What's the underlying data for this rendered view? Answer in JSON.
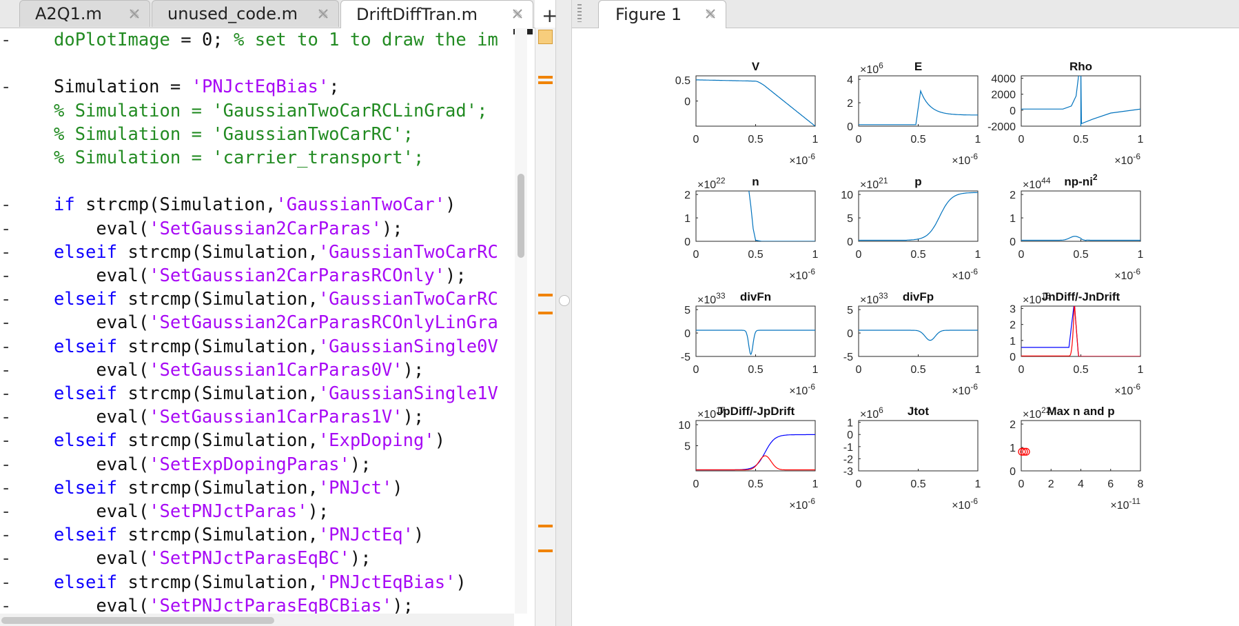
{
  "editor": {
    "tabs": [
      {
        "label": "A2Q1.m",
        "active": false
      },
      {
        "label": "unused_code.m",
        "active": false
      },
      {
        "label": "DriftDiffTran.m",
        "active": true
      }
    ],
    "new_tab_label": "+",
    "lines": [
      {
        "marker": "-",
        "segments": [
          [
            "cm",
            "doPlotImage"
          ],
          [
            "tx",
            " = 0; "
          ],
          [
            "cm",
            "% set to 1 to draw the im"
          ]
        ]
      },
      {
        "marker": "",
        "segments": []
      },
      {
        "marker": "-",
        "segments": [
          [
            "tx",
            "Simulation = "
          ],
          [
            "st",
            "'PNJctEqBias'"
          ],
          [
            "tx",
            ";"
          ]
        ]
      },
      {
        "marker": "",
        "segments": [
          [
            "cm",
            "% Simulation = 'GaussianTwoCarRCLinGrad';"
          ]
        ]
      },
      {
        "marker": "",
        "segments": [
          [
            "cm",
            "% Simulation = 'GaussianTwoCarRC';"
          ]
        ]
      },
      {
        "marker": "",
        "segments": [
          [
            "cm",
            "% Simulation = 'carrier_transport';"
          ]
        ]
      },
      {
        "marker": "",
        "segments": []
      },
      {
        "marker": "-",
        "segments": [
          [
            "kw",
            "if"
          ],
          [
            "tx",
            " strcmp(Simulation,"
          ],
          [
            "st",
            "'GaussianTwoCar'"
          ],
          [
            "tx",
            ")"
          ]
        ]
      },
      {
        "marker": "-",
        "segments": [
          [
            "tx",
            "    eval("
          ],
          [
            "st",
            "'SetGaussian2CarParas'"
          ],
          [
            "tx",
            ");"
          ]
        ]
      },
      {
        "marker": "-",
        "segments": [
          [
            "kw",
            "elseif"
          ],
          [
            "tx",
            " strcmp(Simulation,"
          ],
          [
            "st",
            "'GaussianTwoCarRC"
          ]
        ]
      },
      {
        "marker": "-",
        "segments": [
          [
            "tx",
            "    eval("
          ],
          [
            "st",
            "'SetGaussian2CarParasRCOnly'"
          ],
          [
            "tx",
            ");"
          ]
        ]
      },
      {
        "marker": "-",
        "segments": [
          [
            "kw",
            "elseif"
          ],
          [
            "tx",
            " strcmp(Simulation,"
          ],
          [
            "st",
            "'GaussianTwoCarRC"
          ]
        ]
      },
      {
        "marker": "-",
        "segments": [
          [
            "tx",
            "    eval("
          ],
          [
            "st",
            "'SetGaussian2CarParasRCOnlyLinGra"
          ]
        ]
      },
      {
        "marker": "-",
        "segments": [
          [
            "kw",
            "elseif"
          ],
          [
            "tx",
            " strcmp(Simulation,"
          ],
          [
            "st",
            "'GaussianSingle0V"
          ]
        ]
      },
      {
        "marker": "-",
        "segments": [
          [
            "tx",
            "    eval("
          ],
          [
            "st",
            "'SetGaussian1CarParas0V'"
          ],
          [
            "tx",
            ");"
          ]
        ]
      },
      {
        "marker": "-",
        "segments": [
          [
            "kw",
            "elseif"
          ],
          [
            "tx",
            " strcmp(Simulation,"
          ],
          [
            "st",
            "'GaussianSingle1V"
          ]
        ]
      },
      {
        "marker": "-",
        "segments": [
          [
            "tx",
            "    eval("
          ],
          [
            "st",
            "'SetGaussian1CarParas1V'"
          ],
          [
            "tx",
            ");"
          ]
        ]
      },
      {
        "marker": "-",
        "segments": [
          [
            "kw",
            "elseif"
          ],
          [
            "tx",
            " strcmp(Simulation,"
          ],
          [
            "st",
            "'ExpDoping'"
          ],
          [
            "tx",
            ")"
          ]
        ]
      },
      {
        "marker": "-",
        "segments": [
          [
            "tx",
            "    eval("
          ],
          [
            "st",
            "'SetExpDopingParas'"
          ],
          [
            "tx",
            ");"
          ]
        ]
      },
      {
        "marker": "-",
        "segments": [
          [
            "kw",
            "elseif"
          ],
          [
            "tx",
            " strcmp(Simulation,"
          ],
          [
            "st",
            "'PNJct'"
          ],
          [
            "tx",
            ")"
          ]
        ]
      },
      {
        "marker": "-",
        "segments": [
          [
            "tx",
            "    eval("
          ],
          [
            "st",
            "'SetPNJctParas'"
          ],
          [
            "tx",
            ");"
          ]
        ]
      },
      {
        "marker": "-",
        "segments": [
          [
            "kw",
            "elseif"
          ],
          [
            "tx",
            " strcmp(Simulation,"
          ],
          [
            "st",
            "'PNJctEq'"
          ],
          [
            "tx",
            ")"
          ]
        ]
      },
      {
        "marker": "-",
        "segments": [
          [
            "tx",
            "    eval("
          ],
          [
            "st",
            "'SetPNJctParasEqBC'"
          ],
          [
            "tx",
            ");"
          ]
        ]
      },
      {
        "marker": "-",
        "segments": [
          [
            "kw",
            "elseif"
          ],
          [
            "tx",
            " strcmp(Simulation,"
          ],
          [
            "st",
            "'PNJctEqBias'"
          ],
          [
            "tx",
            ")"
          ]
        ]
      },
      {
        "marker": "-",
        "segments": [
          [
            "tx",
            "    eval("
          ],
          [
            "st",
            "'SetPNJctParasEqBCBias'"
          ],
          [
            "tx",
            ");"
          ]
        ]
      }
    ]
  },
  "figure": {
    "tab_label": "Figure 1",
    "subplots": [
      {
        "title": "V",
        "xticks": [
          "0",
          "0.5",
          "1"
        ],
        "xexp": "-6",
        "yticks": [
          "0",
          "0.5"
        ],
        "yexp": null,
        "color": "#0072bd",
        "shape": "V"
      },
      {
        "title": "E",
        "xticks": [
          "0",
          "0.5",
          "1"
        ],
        "xexp": "-6",
        "yticks": [
          "0",
          "2",
          "4"
        ],
        "yexp": "6",
        "color": "#0072bd",
        "shape": "E"
      },
      {
        "title": "Rho",
        "xticks": [
          "0",
          "0.5",
          "1"
        ],
        "xexp": "-6",
        "yticks": [
          "-2000",
          "0",
          "2000",
          "4000"
        ],
        "yexp": null,
        "color": "#0072bd",
        "shape": "Rho"
      },
      {
        "title": "n",
        "xticks": [
          "0",
          "0.5",
          "1"
        ],
        "xexp": "-6",
        "yticks": [
          "0",
          "1",
          "2"
        ],
        "yexp": "22",
        "color": "#0072bd",
        "shape": "n"
      },
      {
        "title": "p",
        "xticks": [
          "0",
          "0.5",
          "1"
        ],
        "xexp": "-6",
        "yticks": [
          "0",
          "5",
          "10"
        ],
        "yexp": "21",
        "color": "#0072bd",
        "shape": "p"
      },
      {
        "title": "np-ni",
        "title_sup": "2",
        "xticks": [
          "0",
          "0.5",
          "1"
        ],
        "xexp": "-6",
        "yticks": [
          "0",
          "1",
          "2"
        ],
        "yexp": "44",
        "color": "#0072bd",
        "shape": "npni"
      },
      {
        "title": "divFn",
        "xticks": [
          "0",
          "0.5",
          "1"
        ],
        "xexp": "-6",
        "yticks": [
          "-5",
          "0",
          "5"
        ],
        "yexp": "33",
        "color": "#0072bd",
        "shape": "divFn"
      },
      {
        "title": "divFp",
        "xticks": [
          "0",
          "0.5",
          "1"
        ],
        "xexp": "-6",
        "yticks": [
          "-5",
          "0",
          "5"
        ],
        "yexp": "33",
        "color": "#0072bd",
        "shape": "divFp"
      },
      {
        "title": "JnDiff/-JnDrift",
        "xticks": [
          "0",
          "0.5",
          "1"
        ],
        "xexp": "-6",
        "yticks": [
          "0",
          "1",
          "2",
          "3"
        ],
        "yexp": "18",
        "color": "#0000ff",
        "color2": "#ff0000",
        "shape": "Jn"
      },
      {
        "title": "JpDiff/-JpDrift",
        "xticks": [
          "0",
          "0.5",
          "1"
        ],
        "xexp": "-6",
        "yticks": [
          "5",
          "10"
        ],
        "yexp": "17",
        "color": "#0000ff",
        "color2": "#ff0000",
        "shape": "Jp"
      },
      {
        "title": "Jtot",
        "xticks": [
          "0",
          "0.5",
          "1"
        ],
        "xexp": "-6",
        "yticks": [
          "-3",
          "-2",
          "-1",
          "0",
          "1"
        ],
        "yexp": "6",
        "color": "#0072bd",
        "shape": "none"
      },
      {
        "title": "Max n and p",
        "xticks": [
          "0",
          "2",
          "4",
          "6",
          "8"
        ],
        "xexp": "-11",
        "yticks": [
          "0",
          "1",
          "2"
        ],
        "yexp": "22",
        "color": "#ff0000",
        "shape": "max"
      }
    ]
  }
}
